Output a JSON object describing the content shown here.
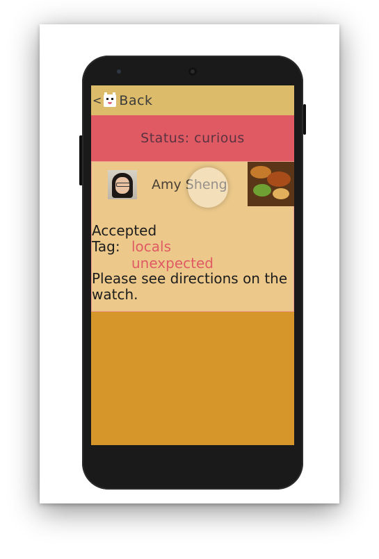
{
  "appbar": {
    "back_chevron": "<",
    "back_label": "Back"
  },
  "status": {
    "text": "Status: curious"
  },
  "match": {
    "user_name": "Amy Sheng",
    "accepted_text": "Accepted",
    "tag_label": "Tag:",
    "tags": [
      "locals",
      "unexpected"
    ],
    "directions": "Please see directions on the watch."
  },
  "colors": {
    "appbar_bg": "#dcbc6a",
    "status_bg": "#e05a64",
    "content_bg": "#ecc98b",
    "screen_bg": "#d6962a",
    "tag_color": "#e05a64"
  },
  "icons": {
    "back": "chevron-left-icon",
    "logo": "app-logo-icon"
  }
}
